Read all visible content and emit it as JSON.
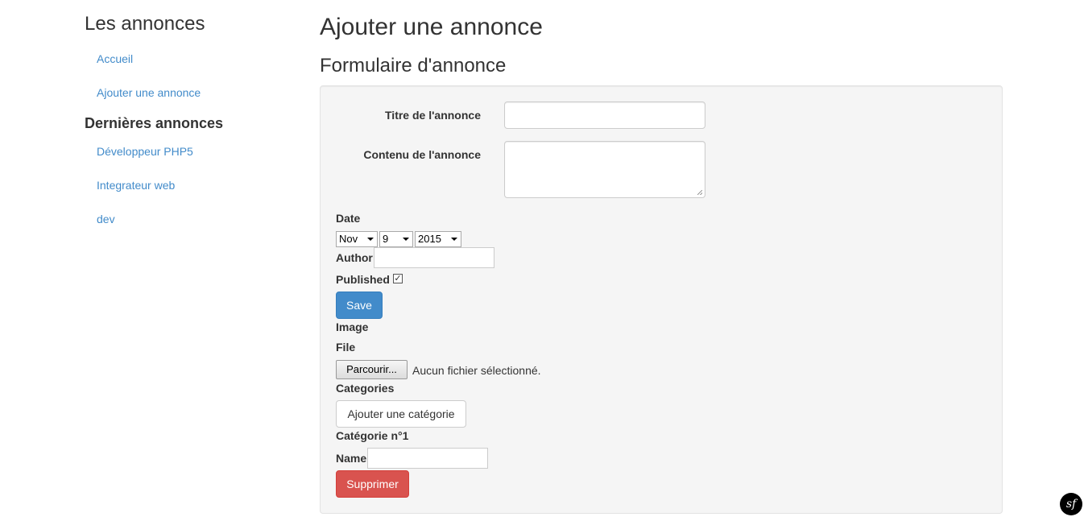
{
  "sidebar": {
    "title": "Les annonces",
    "nav": [
      {
        "label": "Accueil"
      },
      {
        "label": "Ajouter une annonce"
      }
    ],
    "recent_title": "Dernières annonces",
    "recent": [
      {
        "label": "Développeur PHP5"
      },
      {
        "label": "Integrateur web"
      },
      {
        "label": "dev"
      }
    ]
  },
  "main": {
    "page_title": "Ajouter une annonce",
    "form_title": "Formulaire d'annonce"
  },
  "form": {
    "titre_label": "Titre de l'annonce",
    "titre_value": "",
    "contenu_label": "Contenu de l'annonce",
    "contenu_value": "",
    "date_label": "Date",
    "date_month": "Nov",
    "date_day": "9",
    "date_year": "2015",
    "author_label": "Author",
    "author_value": "",
    "published_label": "Published",
    "published_checked": true,
    "save_label": "Save",
    "image_label": "Image",
    "file_label": "File",
    "browse_label": "Parcourir...",
    "file_status": "Aucun fichier sélectionné.",
    "categories_label": "Categories",
    "add_category_label": "Ajouter une catégorie",
    "category_item_label": "Catégorie n°1",
    "name_label": "Name",
    "name_value": "",
    "delete_label": "Supprimer"
  },
  "toolbar": {
    "symfony_badge": "sf"
  },
  "colors": {
    "link": "#428bca",
    "primary": "#428bca",
    "danger": "#d9534f",
    "well_bg": "#f5f5f5"
  }
}
